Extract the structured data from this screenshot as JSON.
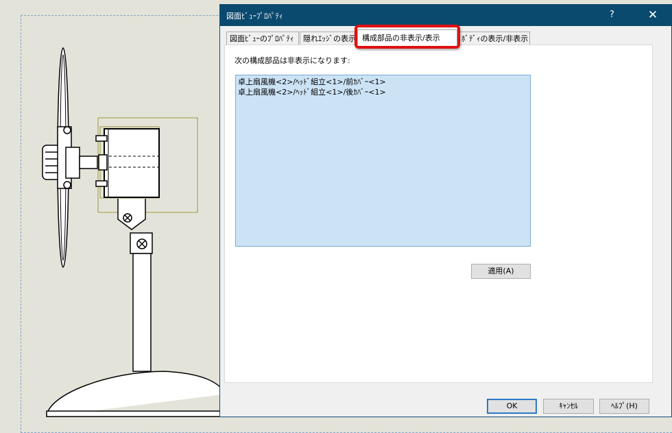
{
  "dialog": {
    "title": "図面ﾋﾞｭｰﾌﾟﾛﾊﾟﾃｨ",
    "help_label": "?",
    "close_label": "✕",
    "tabs": [
      {
        "label": "図面ﾋﾞｭｰのﾌﾟﾛﾊﾟﾃｨ"
      },
      {
        "label": "隠れｴｯｼﾞの表示"
      },
      {
        "label": "構成部品の非表示/表示"
      },
      {
        "label": "ﾎﾞﾃﾞｨの表示/非表示"
      }
    ],
    "active_tab": "構成部品の非表示/表示",
    "panel": {
      "label": "次の構成部品は非表示になります:",
      "hidden_components": [
        "卓上扇風機<2>/ﾍｯﾄﾞ組立<1>/前ｶﾊﾞｰ<1>",
        "卓上扇風機<2>/ﾍｯﾄﾞ組立<1>/後ｶﾊﾞｰ<1>"
      ],
      "apply_label": "適用(A)"
    },
    "footer": {
      "ok_label": "OK",
      "cancel_label": "ｷｬﾝｾﾙ",
      "help_label": "ﾍﾙﾌﾟ(H)"
    }
  },
  "colors": {
    "titlebar": "#0b4a6f",
    "highlight": "#e01010",
    "list_background": "#cce3f6",
    "canvas_background": "#e4e3da"
  }
}
